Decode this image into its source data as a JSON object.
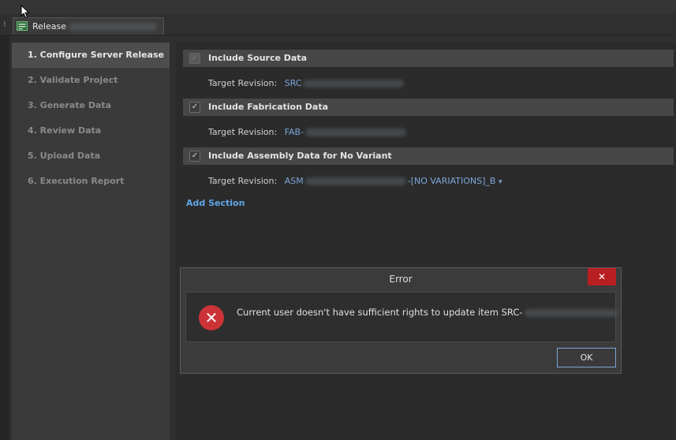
{
  "tab": {
    "left_glyph": "⁝",
    "label": "Release",
    "icon": "release-document-icon"
  },
  "steps": [
    "1. Configure Server Release",
    "2. Validate Project",
    "3. Generate Data",
    "4. Review Data",
    "5. Upload Data",
    "6. Execution Report"
  ],
  "sections": [
    {
      "label": "Include Source Data",
      "checked": true,
      "enabled": false,
      "target_label": "Target Revision:",
      "revision_prefix": "SRC",
      "revision_suffix": ""
    },
    {
      "label": "Include Fabrication Data",
      "checked": true,
      "enabled": true,
      "target_label": "Target Revision:",
      "revision_prefix": "FAB-",
      "revision_suffix": ""
    },
    {
      "label": "Include Assembly Data for No Variant",
      "checked": true,
      "enabled": true,
      "target_label": "Target Revision:",
      "revision_prefix": "ASM",
      "revision_suffix": "-[NO VARIATIONS]_B"
    }
  ],
  "add_section": "Add Section",
  "dropdown_glyph": "▾",
  "dialog": {
    "title": "Error",
    "close_glyph": "✕",
    "icon_glyph": "✕",
    "message": "Current user doesn't have sufficient rights to update item SRC-",
    "ok": "OK"
  },
  "colors": {
    "accent_link": "#5fa7e8",
    "error_red": "#cb3337",
    "close_red": "#b81f22"
  }
}
